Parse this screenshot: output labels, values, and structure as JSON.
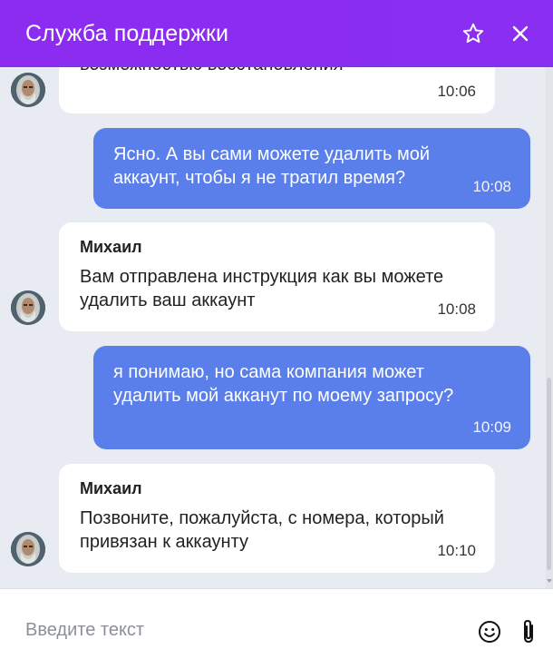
{
  "header": {
    "title": "Служба поддержки",
    "icons": {
      "favorite": "star-icon",
      "close": "close-icon"
    }
  },
  "colors": {
    "header_bg": "#8a2ef2",
    "user_bubble": "#5b7fea",
    "agent_bubble": "#ffffff",
    "chat_bg": "#e8ebf2"
  },
  "messages": [
    {
      "from": "agent",
      "sender": "",
      "text": "возможностью восстановления",
      "time": "10:06"
    },
    {
      "from": "user",
      "text": "Ясно. А вы сами можете удалить мой\nаккаунт, чтобы я не тратил время?",
      "time": "10:08"
    },
    {
      "from": "agent",
      "sender": "Михаил",
      "text": "Вам отправлена инструкция как вы можете\nудалить ваш аккаунт",
      "time": "10:08"
    },
    {
      "from": "user",
      "text": "я понимаю, но сама компания может\nудалить мой акканут по моему запросу?",
      "time": "10:09"
    },
    {
      "from": "agent",
      "sender": "Михаил",
      "text": "Позвоните, пожалуйста, с номера, который\nпривязан к аккаунту",
      "time": "10:10"
    }
  ],
  "input": {
    "placeholder": "Введите текст",
    "value": "",
    "icons": {
      "emoji": "emoji-icon",
      "attach": "paperclip-icon"
    }
  }
}
